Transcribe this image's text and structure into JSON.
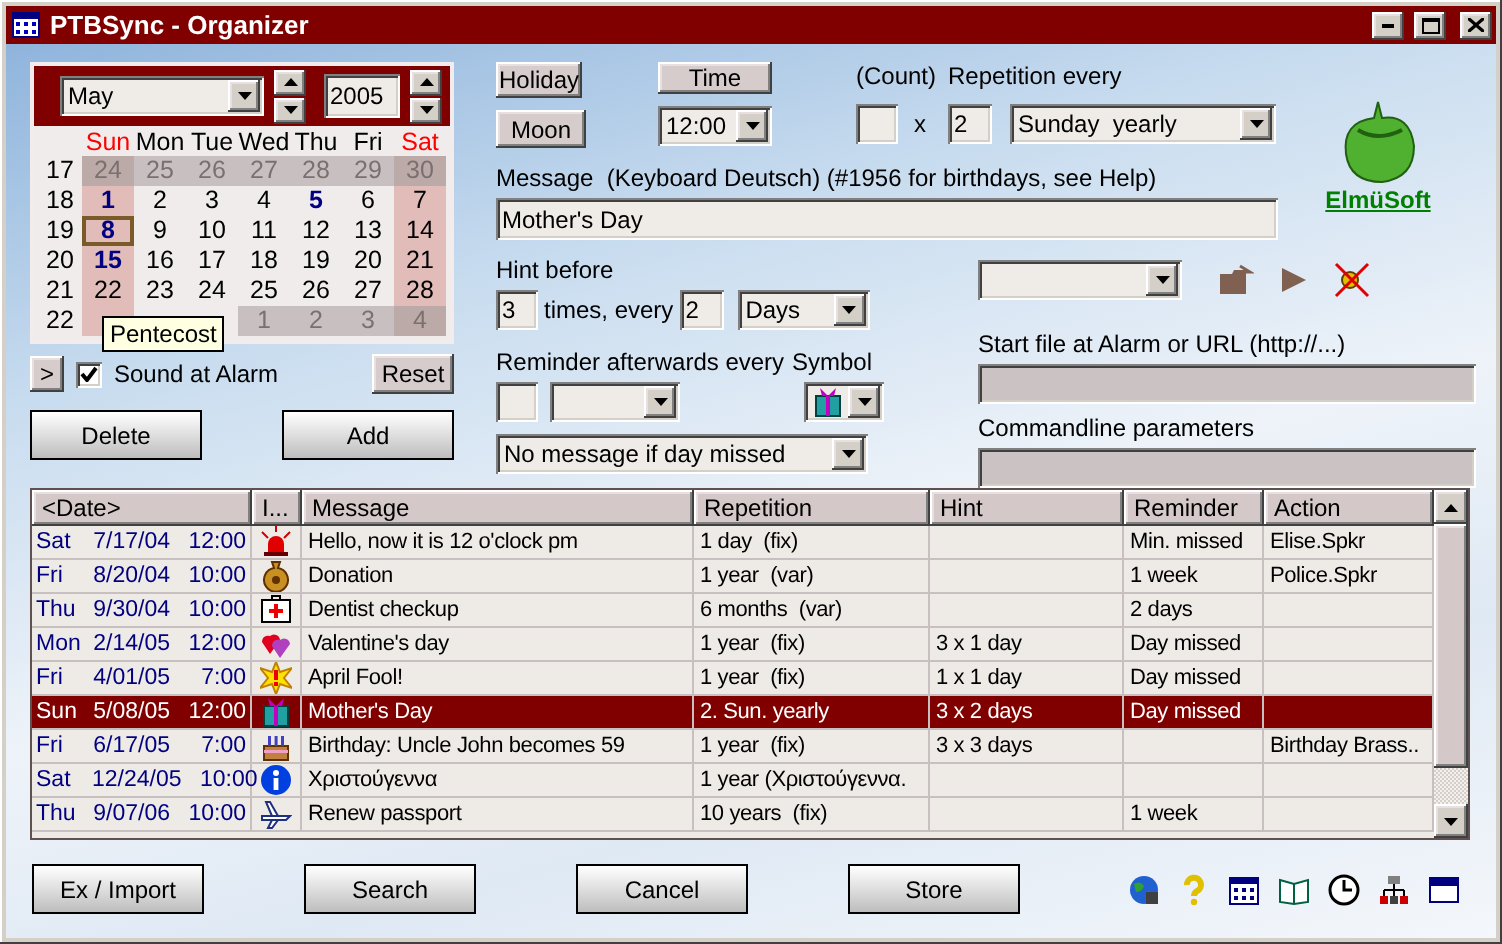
{
  "window": {
    "title": "PTBSync - Organizer"
  },
  "calendar": {
    "month": "May",
    "year": "2005",
    "weekdays": [
      {
        "label": "Sun",
        "weekend": true
      },
      {
        "label": "Mon",
        "weekend": false
      },
      {
        "label": "Tue",
        "weekend": false
      },
      {
        "label": "Wed",
        "weekend": false
      },
      {
        "label": "Thu",
        "weekend": false
      },
      {
        "label": "Fri",
        "weekend": false
      },
      {
        "label": "Sat",
        "weekend": true
      }
    ],
    "weeks": [
      {
        "week": "17",
        "days": [
          {
            "t": "24",
            "other": true,
            "event": false,
            "selected": false
          },
          {
            "t": "25",
            "other": true,
            "event": false,
            "selected": false
          },
          {
            "t": "26",
            "other": true,
            "event": false,
            "selected": false
          },
          {
            "t": "27",
            "other": true,
            "event": false,
            "selected": false
          },
          {
            "t": "28",
            "other": true,
            "event": false,
            "selected": false
          },
          {
            "t": "29",
            "other": true,
            "event": false,
            "selected": false
          },
          {
            "t": "30",
            "other": true,
            "event": false,
            "selected": false
          }
        ]
      },
      {
        "week": "18",
        "days": [
          {
            "t": "1",
            "other": false,
            "event": true,
            "selected": false
          },
          {
            "t": "2",
            "other": false,
            "event": false,
            "selected": false
          },
          {
            "t": "3",
            "other": false,
            "event": false,
            "selected": false
          },
          {
            "t": "4",
            "other": false,
            "event": false,
            "selected": false
          },
          {
            "t": "5",
            "other": false,
            "event": true,
            "selected": false
          },
          {
            "t": "6",
            "other": false,
            "event": false,
            "selected": false
          },
          {
            "t": "7",
            "other": false,
            "event": false,
            "selected": false
          }
        ]
      },
      {
        "week": "19",
        "days": [
          {
            "t": "8",
            "other": false,
            "event": true,
            "selected": true
          },
          {
            "t": "9",
            "other": false,
            "event": false,
            "selected": false
          },
          {
            "t": "10",
            "other": false,
            "event": false,
            "selected": false
          },
          {
            "t": "11",
            "other": false,
            "event": false,
            "selected": false
          },
          {
            "t": "12",
            "other": false,
            "event": false,
            "selected": false
          },
          {
            "t": "13",
            "other": false,
            "event": false,
            "selected": false
          },
          {
            "t": "14",
            "other": false,
            "event": false,
            "selected": false
          }
        ]
      },
      {
        "week": "20",
        "days": [
          {
            "t": "15",
            "other": false,
            "event": true,
            "selected": false
          },
          {
            "t": "16",
            "other": false,
            "event": false,
            "selected": false
          },
          {
            "t": "17",
            "other": false,
            "event": false,
            "selected": false
          },
          {
            "t": "18",
            "other": false,
            "event": false,
            "selected": false
          },
          {
            "t": "19",
            "other": false,
            "event": false,
            "selected": false
          },
          {
            "t": "20",
            "other": false,
            "event": false,
            "selected": false
          },
          {
            "t": "21",
            "other": false,
            "event": false,
            "selected": false
          }
        ]
      },
      {
        "week": "21",
        "days": [
          {
            "t": "22",
            "other": false,
            "event": false,
            "selected": false
          },
          {
            "t": "23",
            "other": false,
            "event": false,
            "selected": false
          },
          {
            "t": "24",
            "other": false,
            "event": false,
            "selected": false
          },
          {
            "t": "25",
            "other": false,
            "event": false,
            "selected": false
          },
          {
            "t": "26",
            "other": false,
            "event": false,
            "selected": false
          },
          {
            "t": "27",
            "other": false,
            "event": false,
            "selected": false
          },
          {
            "t": "28",
            "other": false,
            "event": false,
            "selected": false
          }
        ]
      },
      {
        "week": "22",
        "days": [
          {
            "other": false,
            "selected": false
          },
          {
            "other": false,
            "selected": false
          },
          {
            "other": false,
            "selected": false
          },
          {
            "t": "1",
            "other": true,
            "event": false,
            "selected": false
          },
          {
            "t": "2",
            "other": true,
            "event": false,
            "selected": false
          },
          {
            "t": "3",
            "other": true,
            "event": false,
            "selected": false
          },
          {
            "t": "4",
            "other": true,
            "event": false,
            "selected": false
          }
        ]
      }
    ],
    "tooltip": "Pentecost"
  },
  "expand_button": ">",
  "sound_at_alarm": {
    "label": "Sound at Alarm",
    "checked": true
  },
  "reset_button": "Reset",
  "delete_button": "Delete",
  "add_button": "Add",
  "form": {
    "holiday_button": "Holiday",
    "moon_button": "Moon",
    "time_button": "Time",
    "time": "12:00",
    "count_label": "(Count)",
    "times_sign": "x",
    "repetition_label": "Repetition every",
    "repetition_count": "2",
    "repetition": "Sunday  yearly",
    "message_label": "Message  (Keyboard Deutsch) (#1956 for birthdays, see Help)",
    "message": "Mother's Day",
    "hint_label": "Hint before",
    "hint_times": {
      "value": "3"
    },
    "hint_times_label": "times, every",
    "hint_every": {
      "value": "2"
    },
    "hint_unit": "Days",
    "reminder_label": "Reminder afterwards every",
    "symbol_label": "Symbol",
    "missed_option": "No message if day missed",
    "start_file_label": "Start file at Alarm or URL (http://...)",
    "commandline_label": "Commandline parameters"
  },
  "logo": {
    "text": "ElmüSoft"
  },
  "table": {
    "columns": [
      "<Date>",
      "I...",
      "Message",
      "Repetition",
      "Hint",
      "Reminder",
      "Action"
    ],
    "rows": [
      {
        "weekday": "Sat",
        "date": "7/17/04",
        "time": "12:00",
        "kind": "siren",
        "message": "Hello, now it is 12 o'clock pm",
        "repetition": "1 day  (fix)",
        "reminder": "Min. missed",
        "action": "Elise.Spkr",
        "selected": false
      },
      {
        "weekday": "Fri",
        "date": "8/20/04",
        "time": "10:00",
        "kind": "moneybag",
        "message": "Donation",
        "repetition": "1 year  (var)",
        "reminder": "1 week",
        "action": "Police.Spkr",
        "selected": false
      },
      {
        "weekday": "Thu",
        "date": "9/30/04",
        "time": "10:00",
        "kind": "firstaid",
        "message": "Dentist checkup",
        "repetition": "6 months  (var)",
        "reminder": "2 days",
        "selected": false
      },
      {
        "weekday": "Mon",
        "date": "2/14/05",
        "time": "12:00",
        "kind": "heart",
        "message": "Valentine's day",
        "repetition": "1 year  (fix)",
        "hint": "3 x 1 day",
        "reminder": "Day missed",
        "selected": false
      },
      {
        "weekday": "Fri",
        "date": "4/01/05",
        "time": "7:00",
        "kind": "burst",
        "message": "April Fool!",
        "repetition": "1 year  (fix)",
        "hint": "1 x 1 day",
        "reminder": "Day missed",
        "selected": false
      },
      {
        "weekday": "Sun",
        "date": "5/08/05",
        "time": "12:00",
        "kind": "gift",
        "message": "Mother's Day",
        "repetition": "2. Sun. yearly",
        "hint": "3 x 2 days",
        "reminder": "Day missed",
        "selected": true
      },
      {
        "weekday": "Fri",
        "date": "6/17/05",
        "time": "7:00",
        "kind": "cake",
        "message": "Birthday: Uncle John becomes 59",
        "repetition": "1 year  (fix)",
        "hint": "3 x 3 days",
        "action": "Birthday Brass..",
        "selected": false
      },
      {
        "weekday": "Sat",
        "date": "12/24/05",
        "time": "10:00",
        "kind": "info",
        "message": "Χριστούγεννα",
        "repetition": "1 year (Χριστούγεννα.",
        "selected": false
      },
      {
        "weekday": "Thu",
        "date": "9/07/06",
        "time": "10:00",
        "kind": "plane",
        "message": "Renew passport",
        "repetition": "10 years  (fix)",
        "reminder": "1 week",
        "selected": false
      }
    ]
  },
  "footer_buttons": [
    "Ex / Import",
    "Search",
    "Cancel",
    "Store"
  ]
}
